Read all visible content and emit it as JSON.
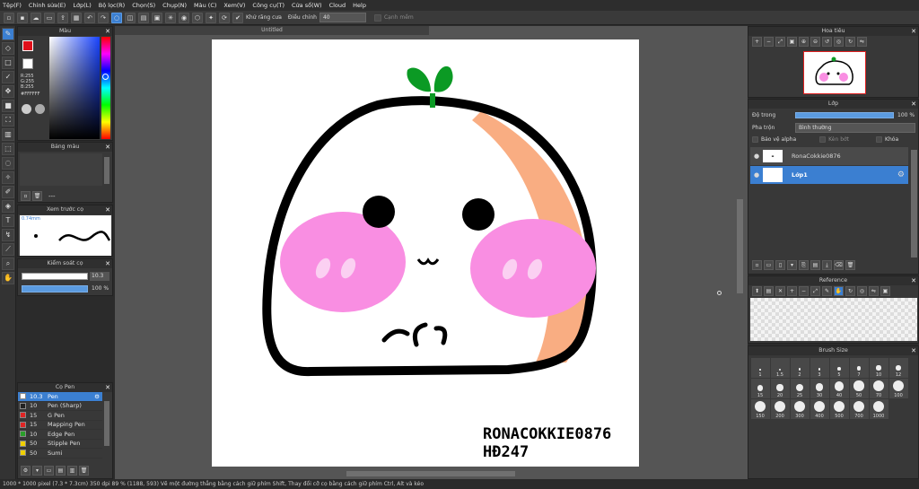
{
  "menu": [
    "Tệp(F)",
    "Chỉnh sửa(E)",
    "Lớp(L)",
    "Bộ lọc(R)",
    "Chọn(S)",
    "Chụp(N)",
    "Màu (C)",
    "Xem(V)",
    "Công cụ(T)",
    "Cửa sổ(W)",
    "Cloud",
    "Help"
  ],
  "toolbar": {
    "antialias_label": "Khử răng cưa",
    "adjust_label": "Điều chỉnh",
    "adjust_value": "40",
    "edge_label": "Cạnh mềm"
  },
  "canvas": {
    "tab_title": "Untitled",
    "signature_line1": "RONACOKKIE0876",
    "signature_line2": "HĐ247"
  },
  "color_panel": {
    "title": "Màu",
    "r": "R:255",
    "g": "G:255",
    "b": "B:255",
    "hex": "#FFFFFF",
    "fg": "#e0101a"
  },
  "swatch_panel": {
    "title": "Bảng màu",
    "dash": "---"
  },
  "preview_panel": {
    "title": "Xem trước cọ",
    "size": "0.74mm"
  },
  "control_panel": {
    "title": "Kiểm soát cọ",
    "size_value": "10.3",
    "opacity_value": "100 %"
  },
  "pen_panel": {
    "title": "Cọ Pen",
    "rows": [
      {
        "size": "10.3",
        "name": "Pen",
        "color": "#ffffff",
        "selected": true
      },
      {
        "size": "10",
        "name": "Pen (Sharp)",
        "color": "#222222"
      },
      {
        "size": "15",
        "name": "G Pen",
        "color": "#e02424"
      },
      {
        "size": "15",
        "name": "Mapping Pen",
        "color": "#e02424"
      },
      {
        "size": "10",
        "name": "Edge Pen",
        "color": "#2aa02a"
      },
      {
        "size": "50",
        "name": "Stipple Pen",
        "color": "#f0d000"
      },
      {
        "size": "50",
        "name": "Sumi",
        "color": "#f0d000"
      }
    ]
  },
  "navigator": {
    "title": "Hoa tiêu"
  },
  "layer_panel": {
    "title": "Lớp",
    "opacity_label": "Độ trong",
    "opacity_value": "100 %",
    "blend_label": "Pha trộn",
    "blend_value": "Bình thường",
    "protect_alpha": "Bảo vệ alpha",
    "clipping": "Kèn bớt",
    "lock": "Khóa",
    "layers": [
      {
        "name": "RonaCokkie0876",
        "selected": false
      },
      {
        "name": "Lớp1",
        "selected": true
      }
    ]
  },
  "reference_panel": {
    "title": "Reference"
  },
  "brush_size_panel": {
    "title": "Brush Size",
    "sizes": [
      "1",
      "1.5",
      "2",
      "3",
      "5",
      "7",
      "10",
      "12",
      "15",
      "20",
      "25",
      "30",
      "40",
      "50",
      "70",
      "100",
      "150",
      "200",
      "300",
      "400",
      "500",
      "700",
      "1000"
    ]
  },
  "status": {
    "text": "1000 * 1000 pixel   (7.3 * 7.3cm)   350 dpi   89 %   (1188, 593)   Vẽ một đường thẳng bằng cách giữ phím Shift, Thay đổi cỡ cọ bằng cách giữ phím Ctrl, Alt và kéo"
  }
}
